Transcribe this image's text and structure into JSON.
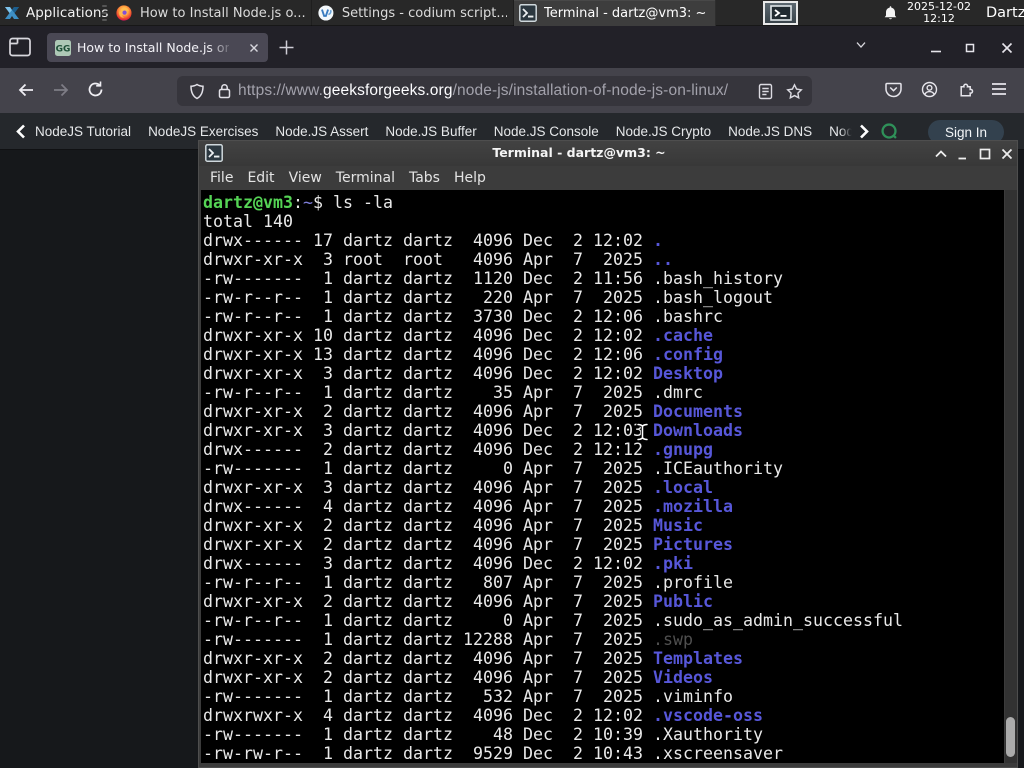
{
  "colors": {
    "panel_bg": "#282828",
    "tabbar_bg": "#222128",
    "navbar_bg": "#44434b",
    "urlbar_bg": "#36353c",
    "tab_active_bg": "#4a4854",
    "subnav_bg": "#25282c",
    "page_bg": "#16181b",
    "terminal_chrome": "#3b3b3b",
    "terminal_bg": "#000000",
    "prompt_green": "#55d455",
    "dir_blue": "#5757d9",
    "gfg_green": "#43b97f",
    "signin_bg": "#33414e"
  },
  "panel": {
    "applications_label": "Applications",
    "windows": [
      {
        "title": "How to Install Node.js o...",
        "icon": "firefox-icon",
        "active": false
      },
      {
        "title": "Settings - codium script...",
        "icon": "codium-icon",
        "active": false
      },
      {
        "title": "Terminal - dartz@vm3: ~",
        "icon": "terminal-icon",
        "active": true
      }
    ],
    "clock_date": "2025-12-02",
    "clock_time": "12:12",
    "user_label": "Dartz"
  },
  "browser": {
    "tab_title": "How to Install Node.js on",
    "url_scheme": "https://www.",
    "url_host": "geeksforgeeks.org",
    "url_path": "/node-js/installation-of-node-js-on-linux/"
  },
  "page": {
    "nav_items": [
      "NodeJS Tutorial",
      "NodeJS Exercises",
      "Node.JS Assert",
      "Node.JS Buffer",
      "Node.JS Console",
      "Node.JS Crypto",
      "Node.JS DNS",
      "Node"
    ],
    "sign_in_label": "Sign In"
  },
  "terminal": {
    "title": "Terminal - dartz@vm3: ~",
    "menu": [
      "File",
      "Edit",
      "View",
      "Terminal",
      "Tabs",
      "Help"
    ],
    "lines": [
      [
        [
          "dartz@vm3",
          "green"
        ],
        [
          ":",
          "fg"
        ],
        [
          "~",
          "tilde"
        ],
        [
          "$ ls -la",
          "fg"
        ]
      ],
      [
        [
          "total 140",
          "fg"
        ]
      ],
      [
        [
          "drwx------ 17 dartz dartz  4096 Dec  2 12:02 ",
          "fg"
        ],
        [
          ".",
          "dir"
        ]
      ],
      [
        [
          "drwxr-xr-x  3 root  root   4096 Apr  7  2025 ",
          "fg"
        ],
        [
          "..",
          "dir"
        ]
      ],
      [
        [
          "-rw-------  1 dartz dartz  1120 Dec  2 11:56 .bash_history",
          "fg"
        ]
      ],
      [
        [
          "-rw-r--r--  1 dartz dartz   220 Apr  7  2025 .bash_logout",
          "fg"
        ]
      ],
      [
        [
          "-rw-r--r--  1 dartz dartz  3730 Dec  2 12:06 .bashrc",
          "fg"
        ]
      ],
      [
        [
          "drwxr-xr-x 10 dartz dartz  4096 Dec  2 12:02 ",
          "fg"
        ],
        [
          ".cache",
          "dir"
        ]
      ],
      [
        [
          "drwxr-xr-x 13 dartz dartz  4096 Dec  2 12:06 ",
          "fg"
        ],
        [
          ".config",
          "dir"
        ]
      ],
      [
        [
          "drwxr-xr-x  3 dartz dartz  4096 Dec  2 12:02 ",
          "fg"
        ],
        [
          "Desktop",
          "dir"
        ]
      ],
      [
        [
          "-rw-r--r--  1 dartz dartz    35 Apr  7  2025 .dmrc",
          "fg"
        ]
      ],
      [
        [
          "drwxr-xr-x  2 dartz dartz  4096 Apr  7  2025 ",
          "fg"
        ],
        [
          "Documents",
          "dir"
        ]
      ],
      [
        [
          "drwxr-xr-x  3 dartz dartz  4096 Dec  2 12:03 ",
          "fg"
        ],
        [
          "Downloads",
          "dir"
        ]
      ],
      [
        [
          "drwx------  2 dartz dartz  4096 Dec  2 12:12 ",
          "fg"
        ],
        [
          ".gnupg",
          "dir"
        ]
      ],
      [
        [
          "-rw-------  1 dartz dartz     0 Apr  7  2025 .ICEauthority",
          "fg"
        ]
      ],
      [
        [
          "drwxr-xr-x  3 dartz dartz  4096 Apr  7  2025 ",
          "fg"
        ],
        [
          ".local",
          "dir"
        ]
      ],
      [
        [
          "drwx------  4 dartz dartz  4096 Apr  7  2025 ",
          "fg"
        ],
        [
          ".mozilla",
          "dir"
        ]
      ],
      [
        [
          "drwxr-xr-x  2 dartz dartz  4096 Apr  7  2025 ",
          "fg"
        ],
        [
          "Music",
          "dir"
        ]
      ],
      [
        [
          "drwxr-xr-x  2 dartz dartz  4096 Apr  7  2025 ",
          "fg"
        ],
        [
          "Pictures",
          "dir"
        ]
      ],
      [
        [
          "drwx------  3 dartz dartz  4096 Dec  2 12:02 ",
          "fg"
        ],
        [
          ".pki",
          "dir"
        ]
      ],
      [
        [
          "-rw-r--r--  1 dartz dartz   807 Apr  7  2025 .profile",
          "fg"
        ]
      ],
      [
        [
          "drwxr-xr-x  2 dartz dartz  4096 Apr  7  2025 ",
          "fg"
        ],
        [
          "Public",
          "dir"
        ]
      ],
      [
        [
          "-rw-r--r--  1 dartz dartz     0 Apr  7  2025 .sudo_as_admin_successful",
          "fg"
        ]
      ],
      [
        [
          "-rw-------  1 dartz dartz 12288 Apr  7  2025 ",
          "fg"
        ],
        [
          ".swp",
          "dim"
        ]
      ],
      [
        [
          "drwxr-xr-x  2 dartz dartz  4096 Apr  7  2025 ",
          "fg"
        ],
        [
          "Templates",
          "dir"
        ]
      ],
      [
        [
          "drwxr-xr-x  2 dartz dartz  4096 Apr  7  2025 ",
          "fg"
        ],
        [
          "Videos",
          "dir"
        ]
      ],
      [
        [
          "-rw-------  1 dartz dartz   532 Apr  7  2025 .viminfo",
          "fg"
        ]
      ],
      [
        [
          "drwxrwxr-x  4 dartz dartz  4096 Dec  2 12:02 ",
          "fg"
        ],
        [
          ".vscode-oss",
          "dir"
        ]
      ],
      [
        [
          "-rw-------  1 dartz dartz    48 Dec  2 10:39 .Xauthority",
          "fg"
        ]
      ],
      [
        [
          "-rw-rw-r--  1 dartz dartz  9529 Dec  2 10:43 .xscreensaver",
          "fg"
        ]
      ]
    ]
  }
}
